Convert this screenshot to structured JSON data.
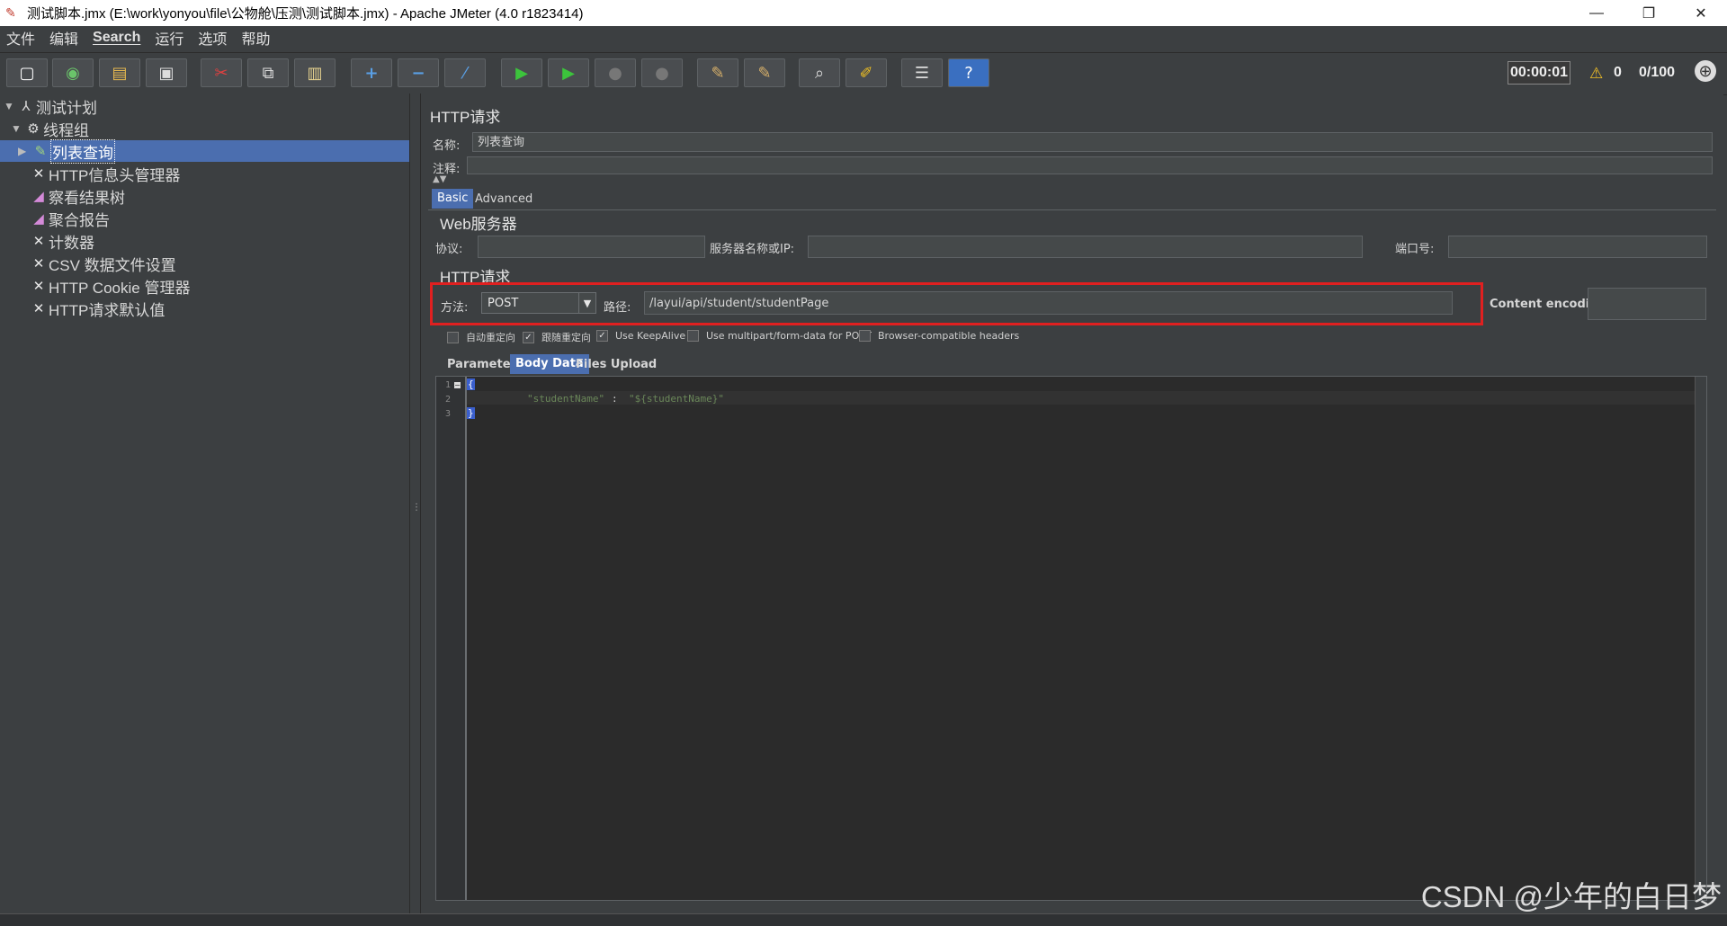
{
  "window": {
    "title": "测试脚本.jmx (E:\\work\\yonyou\\file\\公物舱\\压测\\测试脚本.jmx) - Apache JMeter (4.0 r1823414)",
    "controls": {
      "minimize": "—",
      "restore": "❐",
      "close": "✕"
    }
  },
  "menu": [
    "文件",
    "编辑",
    "Search",
    "运行",
    "选项",
    "帮助"
  ],
  "toolbar": {
    "buttons": [
      {
        "icon": "new-icon",
        "glyph": "▢"
      },
      {
        "icon": "templates-icon",
        "glyph": "◉"
      },
      {
        "icon": "open-icon",
        "glyph": "▤"
      },
      {
        "icon": "save-icon",
        "glyph": "▣"
      },
      {
        "icon": "cut-icon",
        "glyph": "✂"
      },
      {
        "icon": "copy-icon",
        "glyph": "⧉"
      },
      {
        "icon": "paste-icon",
        "glyph": "▥"
      },
      {
        "icon": "expand-icon",
        "glyph": "+"
      },
      {
        "icon": "collapse-icon",
        "glyph": "−"
      },
      {
        "icon": "toggle-icon",
        "glyph": "⁄"
      },
      {
        "icon": "start-icon",
        "glyph": "▶"
      },
      {
        "icon": "start-no-pause-icon",
        "glyph": "▶"
      },
      {
        "icon": "stop-icon",
        "glyph": "●"
      },
      {
        "icon": "shutdown-icon",
        "glyph": "●"
      },
      {
        "icon": "clear-icon",
        "glyph": "✎"
      },
      {
        "icon": "clear-all-icon",
        "glyph": "✎"
      },
      {
        "icon": "search-icon",
        "glyph": "⌕"
      },
      {
        "icon": "reset-search-icon",
        "glyph": "✐"
      },
      {
        "icon": "function-helper-icon",
        "glyph": "☰"
      },
      {
        "icon": "help-icon",
        "glyph": "?"
      }
    ],
    "timer": "00:00:01",
    "warning_count": "0",
    "threads": "0/100"
  },
  "tree": [
    {
      "label": "测试计划",
      "icon": "test-plan-icon",
      "glyph": "⅄",
      "arrow": "▼",
      "level": 0
    },
    {
      "label": "线程组",
      "icon": "thread-group-icon",
      "glyph": "⚙",
      "arrow": "▼",
      "level": 1
    },
    {
      "label": "列表查询",
      "icon": "http-sampler-icon",
      "glyph": "✎",
      "arrow": "▶",
      "level": 2,
      "selected": true
    },
    {
      "label": "HTTP信息头管理器",
      "icon": "config-icon",
      "glyph": "✕",
      "arrow": "",
      "level": 2
    },
    {
      "label": "察看结果树",
      "icon": "listener-icon",
      "glyph": "◢",
      "arrow": "",
      "level": 2
    },
    {
      "label": "聚合报告",
      "icon": "listener-icon",
      "glyph": "◢",
      "arrow": "",
      "level": 2
    },
    {
      "label": "计数器",
      "icon": "config-icon",
      "glyph": "✕",
      "arrow": "",
      "level": 2
    },
    {
      "label": "CSV 数据文件设置",
      "icon": "config-icon",
      "glyph": "✕",
      "arrow": "",
      "level": 2
    },
    {
      "label": "HTTP Cookie 管理器",
      "icon": "config-icon",
      "glyph": "✕",
      "arrow": "",
      "level": 2
    },
    {
      "label": "HTTP请求默认值",
      "icon": "config-icon",
      "glyph": "✕",
      "arrow": "",
      "level": 2
    }
  ],
  "panel": {
    "title": "HTTP请求",
    "name_label": "名称:",
    "name_value": "列表查询",
    "comment_label": "注释:",
    "comment_value": "",
    "tabs": [
      "Basic",
      "Advanced"
    ],
    "web_server": {
      "title": "Web服务器",
      "protocol_label": "协议:",
      "protocol_value": "",
      "server_label": "服务器名称或IP:",
      "server_value": "",
      "port_label": "端口号:",
      "port_value": ""
    },
    "http_request": {
      "title": "HTTP请求",
      "method_label": "方法:",
      "method_value": "POST",
      "path_label": "路径:",
      "path_value": "/layui/api/student/studentPage",
      "encoding_label": "Content encoding:",
      "encoding_value": ""
    },
    "checkboxes": [
      {
        "label": "自动重定向",
        "checked": false
      },
      {
        "label": "跟随重定向",
        "checked": true
      },
      {
        "label": "Use KeepAlive",
        "checked": true
      },
      {
        "label": "Use multipart/form-data for POST",
        "checked": false
      },
      {
        "label": "Browser-compatible headers",
        "checked": false
      }
    ],
    "body_tabs": [
      "Parameters",
      "Body Data",
      "Files Upload"
    ],
    "body": {
      "lines": [
        "1",
        "2",
        "3"
      ],
      "open_brace": "{",
      "key": "\"studentName\"",
      "colon": ":",
      "value": "\"${studentName}\"",
      "close_brace": "}"
    }
  },
  "watermark": "CSDN @少年的白日梦"
}
